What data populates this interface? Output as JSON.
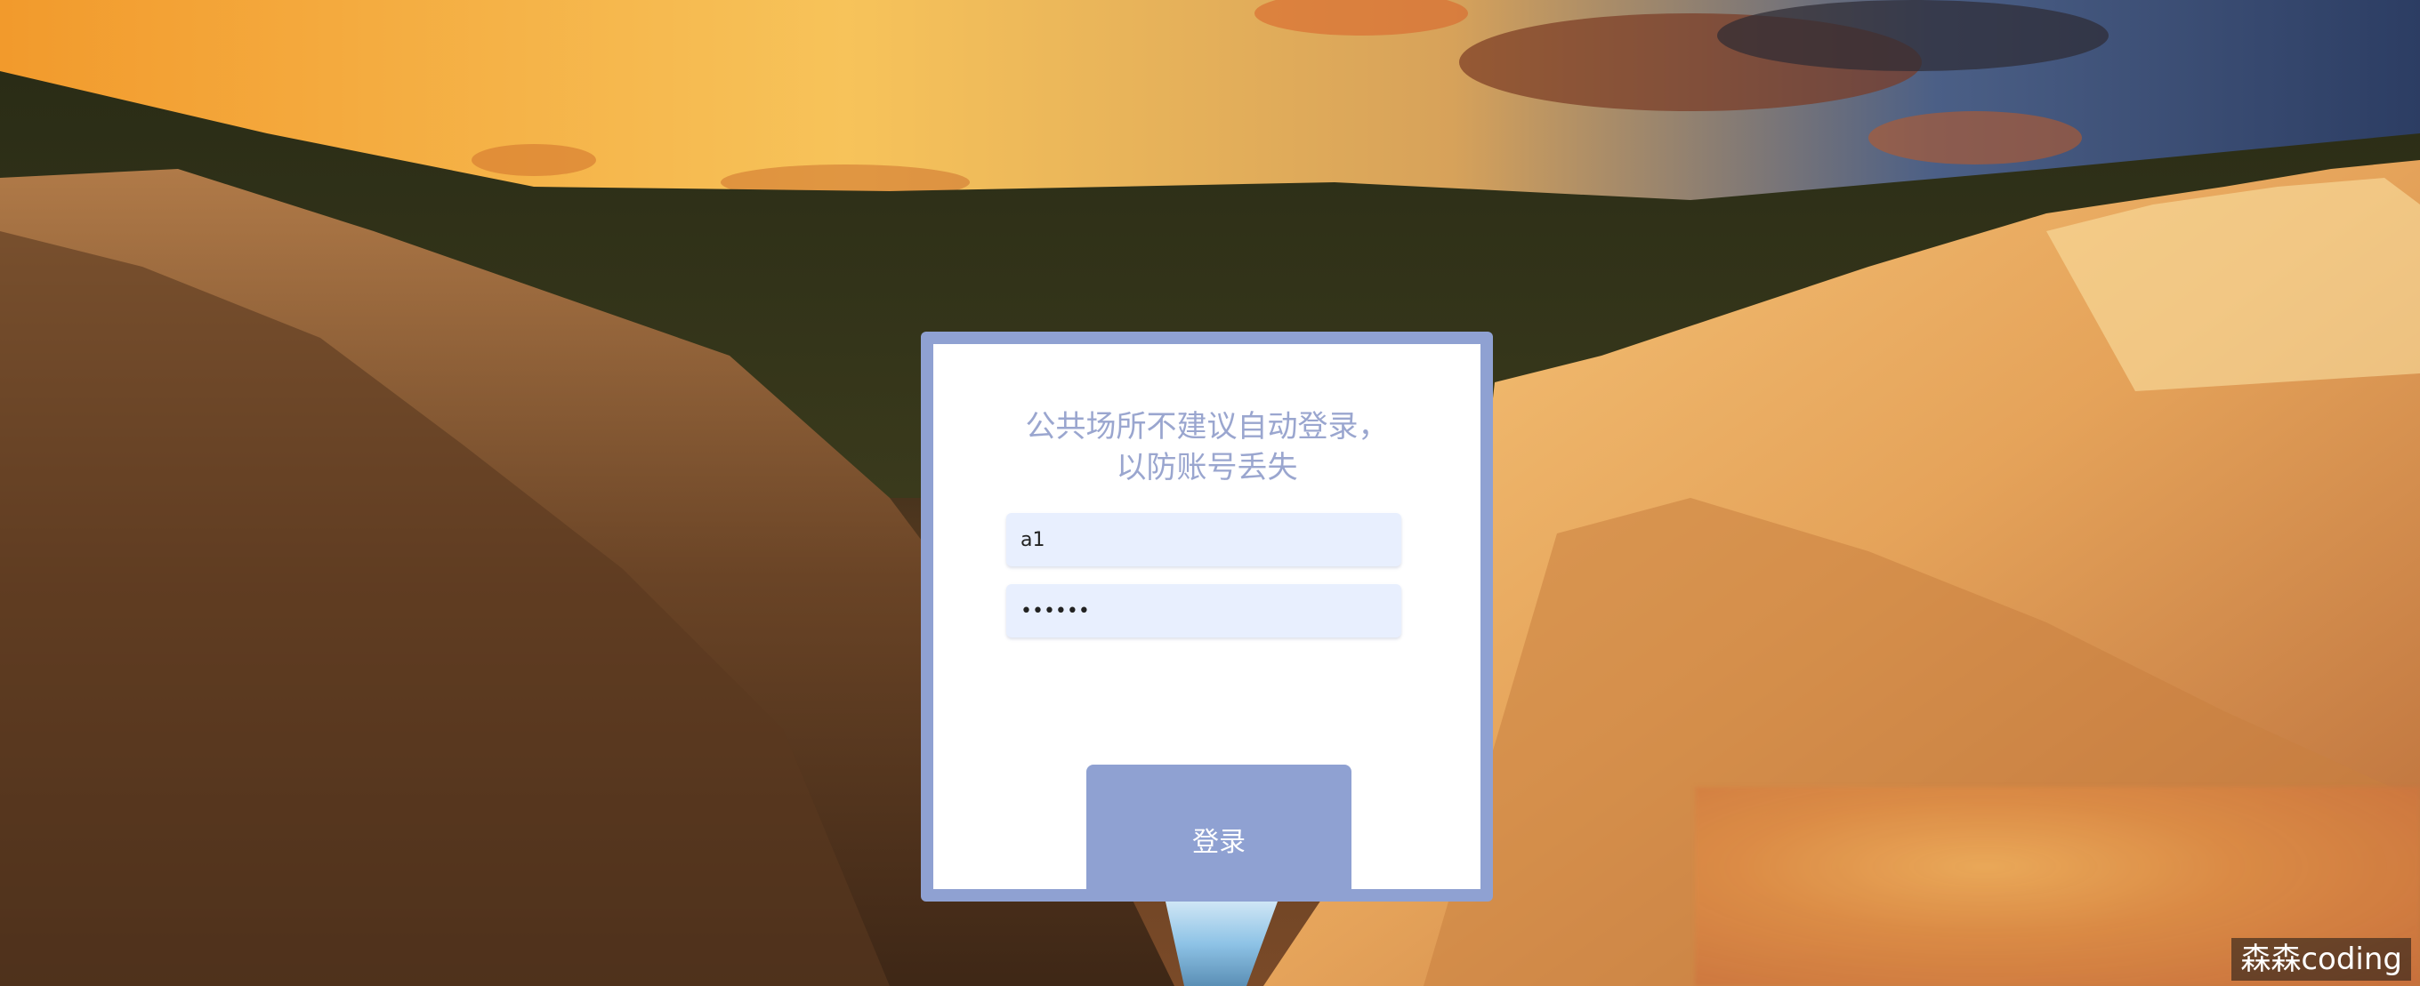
{
  "login": {
    "title_line1": "公共场所不建议自动登录，",
    "title_line2": "以防账号丢失",
    "username_value": "a1",
    "password_value": "••••••",
    "submit_label": "登录"
  },
  "watermark": {
    "text": "森森coding"
  },
  "colors": {
    "accent": "#8fa1d2",
    "title_text": "#9aa6cf",
    "input_bg": "#e8effe"
  }
}
